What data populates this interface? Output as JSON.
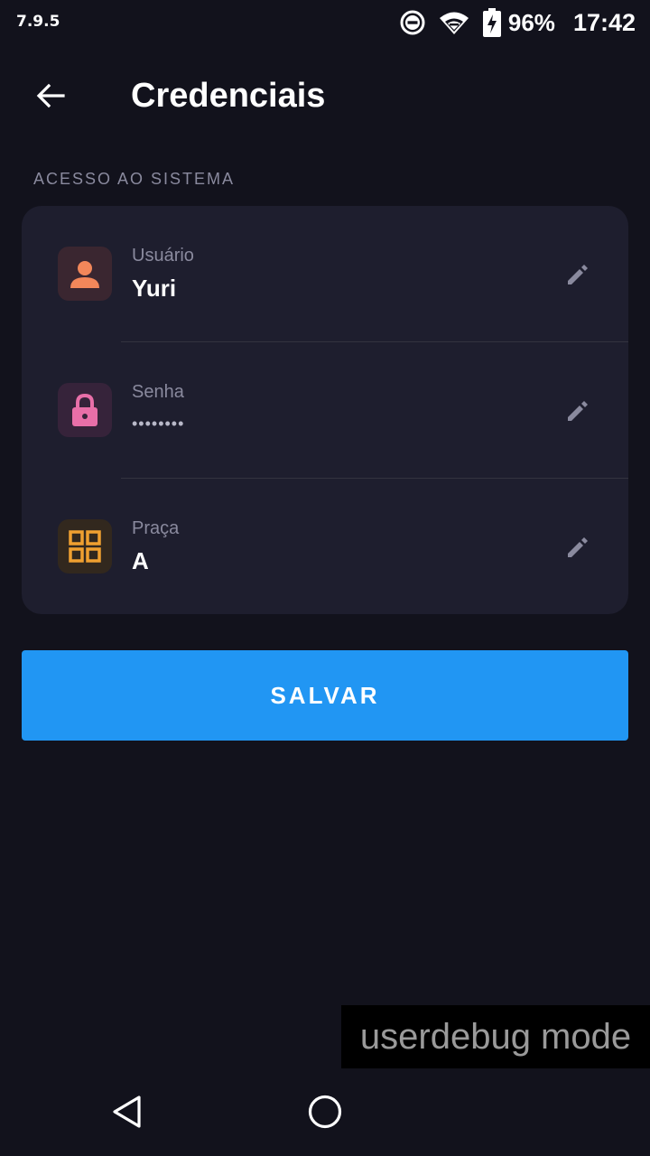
{
  "status_bar": {
    "version": "7.9.5",
    "battery_percent": "96%",
    "time": "17:42",
    "icons": [
      "do-not-disturb-icon",
      "wifi-icon",
      "battery-charging-icon"
    ]
  },
  "app_bar": {
    "back_icon": "arrow-left-icon",
    "title": "Credenciais"
  },
  "section": {
    "label": "ACESSO AO SISTEMA"
  },
  "credentials": [
    {
      "id": "usuario",
      "icon": "person-icon",
      "icon_color": "#f2875a",
      "icon_bg": "#3a2630",
      "label": "Usuário",
      "value": "Yuri",
      "masked": false
    },
    {
      "id": "senha",
      "icon": "lock-icon",
      "icon_color": "#e86fa8",
      "icon_bg": "#36233a",
      "label": "Senha",
      "value": "••••••••",
      "masked": true
    },
    {
      "id": "praca",
      "icon": "grid-icon",
      "icon_color": "#f0a030",
      "icon_bg": "#32281e",
      "label": "Praça",
      "value": "A",
      "masked": false
    }
  ],
  "actions": {
    "save_label": "SALVAR",
    "save_color": "#2196f3"
  },
  "debug_overlay": {
    "text": "userdebug mode"
  },
  "nav_bar": {
    "icons": [
      "nav-back-icon",
      "nav-home-icon"
    ]
  }
}
